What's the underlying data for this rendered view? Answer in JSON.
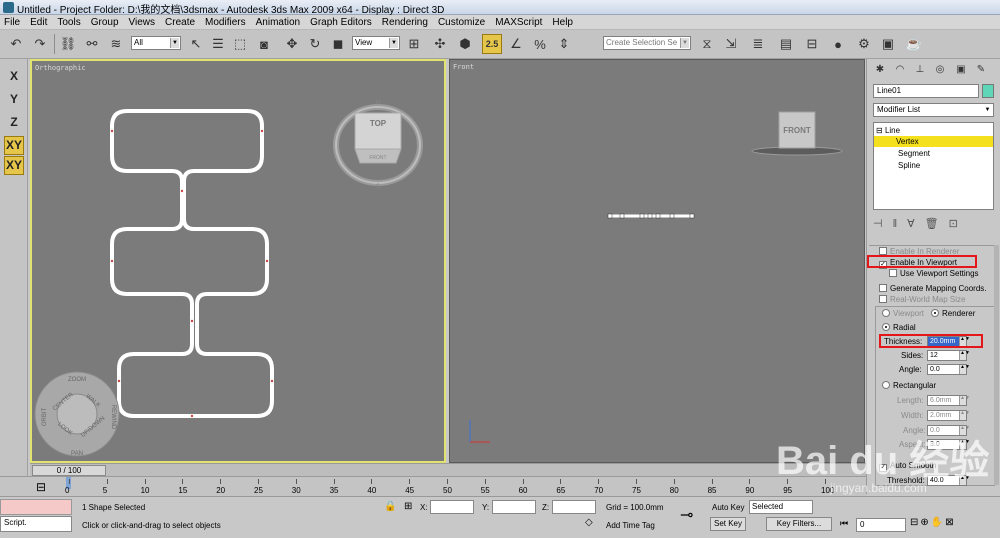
{
  "window": {
    "title": "Untitled    - Project Folder: D:\\我的文档\\3dsmax    - Autodesk 3ds Max  2009 x64     - Display : Direct 3D"
  },
  "menu": [
    "File",
    "Edit",
    "Tools",
    "Group",
    "Views",
    "Create",
    "Modifiers",
    "Animation",
    "Graph Editors",
    "Rendering",
    "Customize",
    "MAXScript",
    "Help"
  ],
  "toolbar": {
    "selection_filter": "All",
    "reference_coord": "View",
    "snap_number": "2.5",
    "selection_set_placeholder": "Create Selection Se"
  },
  "axis_constraints": [
    "X",
    "Y",
    "Z",
    "XY",
    "XY"
  ],
  "viewports": {
    "left_label": "Orthographic",
    "right_label": "Front",
    "viewcube_left": "TOP",
    "viewcube_left_sub": "FRONT",
    "viewcube_right": "FRONT"
  },
  "steering_wheel": {
    "zoom": "ZOOM",
    "orbit": "ORBIT",
    "center": "CENTER",
    "walk": "WALK",
    "look": "LOOK",
    "updown": "UP/DOWN",
    "rewind": "REWIND",
    "pan": "PAN"
  },
  "command_panel": {
    "object_name": "Line01",
    "object_color": "#5fd6b8",
    "modifier_list": "Modifier List",
    "stack": [
      "Line",
      "Vertex",
      "Segment",
      "Spline"
    ],
    "rendering": {
      "enable_in_renderer": "Enable In Renderer",
      "enable_in_viewport": "Enable In Viewport",
      "use_viewport_settings": "Use Viewport Settings",
      "generate_mapping": "Generate Mapping Coords.",
      "real_world_map": "Real-World Map Size",
      "viewport": "Viewport",
      "renderer": "Renderer",
      "radial": "Radial",
      "thickness_label": "Thickness:",
      "thickness_value": "20.0mm",
      "sides_label": "Sides:",
      "sides_value": "12",
      "angle_label": "Angle:",
      "angle_value": "0.0",
      "rectangular": "Rectangular",
      "length_label": "Length:",
      "length_value": "6.0mm",
      "width_label": "Width:",
      "width_value": "2.0mm",
      "angle2_label": "Angle:",
      "angle2_value": "0.0",
      "aspect_label": "Aspect:",
      "aspect_value": "3.0",
      "auto_smooth": "Auto Smooth",
      "threshold_label": "Threshold:",
      "threshold_value": "40.0"
    }
  },
  "timeline": {
    "frame": "0 / 100",
    "ticks": [
      "0",
      "5",
      "10",
      "15",
      "20",
      "25",
      "30",
      "35",
      "40",
      "45",
      "50",
      "55",
      "60",
      "65",
      "70",
      "75",
      "80",
      "85",
      "90",
      "95",
      "100"
    ]
  },
  "status": {
    "maxscript": "Script.",
    "selection": "1 Shape Selected",
    "prompt": "Click or click-and-drag to select objects",
    "x_label": "X:",
    "y_label": "Y:",
    "z_label": "Z:",
    "grid": "Grid = 100.0mm",
    "add_time_tag": "Add Time Tag",
    "auto_key": "Auto Key",
    "set_key": "Set Key",
    "key_mode": "Selected",
    "key_filters": "Key Filters...",
    "current_frame": "0"
  },
  "watermark": "Bai du 经验",
  "watermark_url": "jingyan.baidu.com",
  "colors": {
    "viewport_bg": "#7b7b7b",
    "active_border": "#e2e26e",
    "highlight": "#f0e020",
    "annotation": "#e3161a"
  }
}
